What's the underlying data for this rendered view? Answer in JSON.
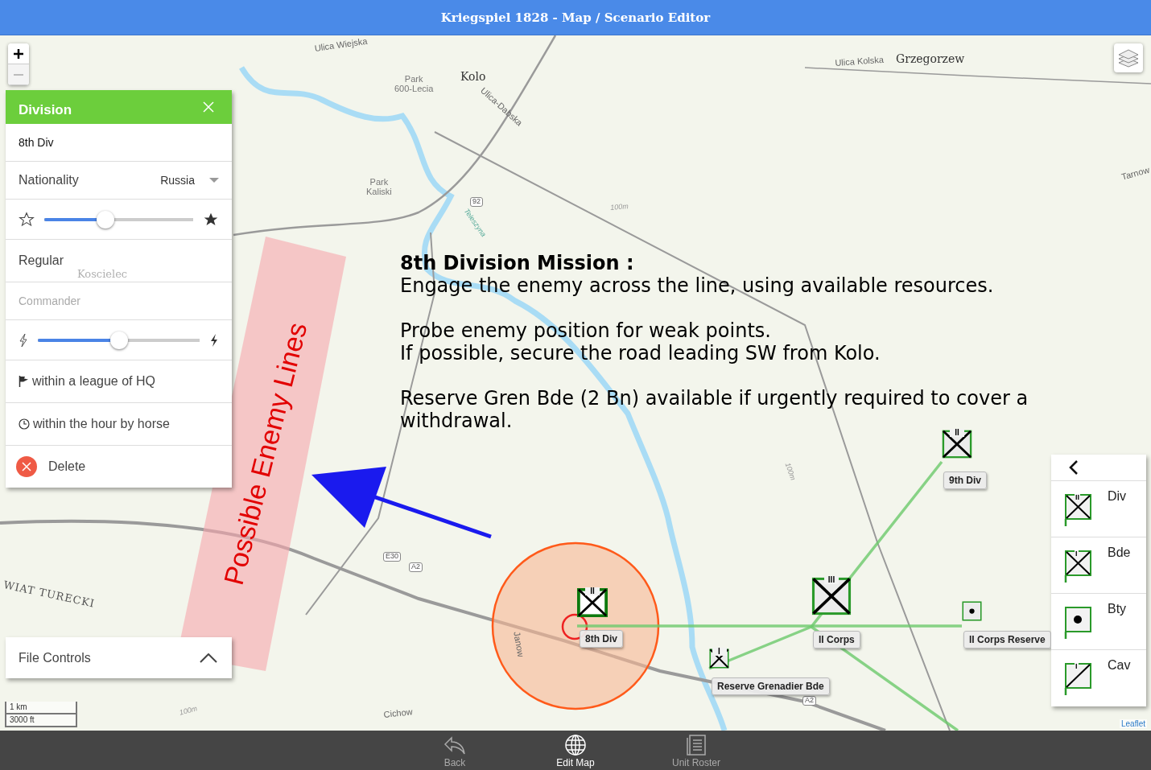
{
  "window": {
    "title": "Kriegspiel 1828 - Map / Scenario Editor"
  },
  "map": {
    "labels": [
      {
        "text": "Ulica Wiejska",
        "kind": "street"
      },
      {
        "text": "Kolo",
        "kind": "place"
      },
      {
        "text": "Park\n600-Lecia",
        "kind": "park"
      },
      {
        "text": "Park\nKaliski",
        "kind": "park"
      },
      {
        "text": "Ulica-Dabska",
        "kind": "street"
      },
      {
        "text": "Ulica Kolska",
        "kind": "street"
      },
      {
        "text": "Grzegorzew",
        "kind": "place"
      },
      {
        "text": "Koscielec",
        "kind": "faint"
      },
      {
        "text": "Cichow",
        "kind": "street"
      },
      {
        "text": "Janow",
        "kind": "street"
      },
      {
        "text": "WIAT TURECKI",
        "kind": "region"
      },
      {
        "text": "92",
        "kind": "shield"
      },
      {
        "text": "E30",
        "kind": "shield"
      },
      {
        "text": "A2",
        "kind": "shield"
      },
      {
        "text": "A2",
        "kind": "shield"
      },
      {
        "text": "Tarnow",
        "kind": "street"
      },
      {
        "text": "100m",
        "kind": "contour"
      },
      {
        "text": "100m",
        "kind": "contour"
      },
      {
        "text": "100m",
        "kind": "contour"
      },
      {
        "text": "Teleszyna",
        "kind": "river"
      }
    ],
    "enemy_zone_label": "Possible Enemy Lines",
    "mission": {
      "title": "8th Division Mission :",
      "paragraphs": [
        "Engage the enemy across the line, using available resources.",
        "Probe enemy position for weak points.\nIf possible, secure the road leading SW from Kolo.",
        "Reserve Gren Bde (2 Bn) available if urgently required to cover a withdrawal."
      ]
    },
    "units": [
      {
        "label": "8th Div",
        "echelon": "II",
        "kind": "infantry",
        "selected": true
      },
      {
        "label": "9th Div",
        "echelon": "II",
        "kind": "infantry",
        "selected": false
      },
      {
        "label": "II Corps",
        "echelon": "III",
        "kind": "infantry",
        "selected": false
      },
      {
        "label": "Reserve Grenadier Bde",
        "echelon": "I",
        "kind": "infantry",
        "selected": false
      },
      {
        "label": "II Corps Reserve",
        "kind": "artillery",
        "selected": false
      }
    ],
    "scale": {
      "metric": "1 km",
      "imperial": "3000 ft"
    },
    "attribution": "Leaflet"
  },
  "unit_panel": {
    "title": "Division",
    "name": "8th Div",
    "nationality_label": "Nationality",
    "nationality": "Russia",
    "quality": {
      "level": 0.41
    },
    "quality_label": "Regular",
    "commander": {
      "placeholder": "Commander"
    },
    "fatigue": {
      "level": 0.5
    },
    "orders": [
      {
        "kind": "flag",
        "text": "within a league of HQ"
      },
      {
        "kind": "clock",
        "text": "within the hour by horse"
      }
    ],
    "delete": "Delete"
  },
  "file_controls": {
    "label": "File Controls",
    "expanded": false
  },
  "palette": {
    "items": [
      {
        "label": "Div",
        "echelon": "II",
        "kind": "infantry"
      },
      {
        "label": "Bde",
        "echelon": "I",
        "kind": "infantry"
      },
      {
        "label": "Bty",
        "kind": "artillery"
      },
      {
        "label": "Cav",
        "echelon": "I",
        "kind": "cavalry"
      }
    ]
  },
  "bottom_nav": [
    {
      "label": "Back",
      "selected": false
    },
    {
      "label": "Edit Map",
      "selected": true
    },
    {
      "label": "Unit Roster",
      "selected": false
    }
  ]
}
